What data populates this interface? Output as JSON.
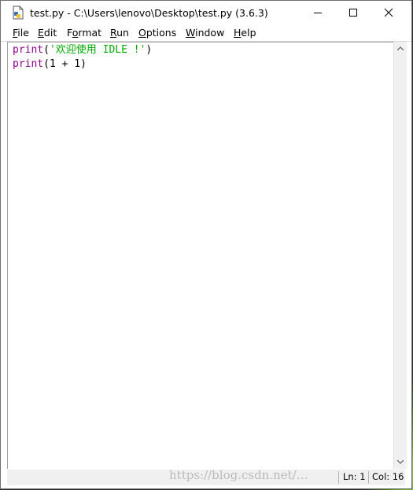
{
  "window": {
    "title": "test.py - C:\\Users\\lenovo\\Desktop\\test.py (3.6.3)"
  },
  "menu": [
    {
      "accel": "F",
      "rest": "ile"
    },
    {
      "accel": "E",
      "rest": "dit"
    },
    {
      "accel": "",
      "pre": "F",
      "accel2": "o",
      "rest": "rmat"
    },
    {
      "accel": "R",
      "rest": "un"
    },
    {
      "accel": "O",
      "rest": "ptions"
    },
    {
      "accel": "W",
      "rest": "indow"
    },
    {
      "accel": "H",
      "rest": "elp"
    }
  ],
  "editor": {
    "line1": {
      "fn": "print",
      "open": "(",
      "string": "'欢迎使用 IDLE !'",
      "close": ")"
    },
    "line2": {
      "fn": "print",
      "args": "(1 + 1)"
    }
  },
  "status": {
    "ln": "Ln: 1",
    "col": "Col: 16"
  },
  "watermark": "https://blog.csdn.net/…",
  "colors": {
    "keyword": "#900090",
    "string": "#00aa00"
  }
}
